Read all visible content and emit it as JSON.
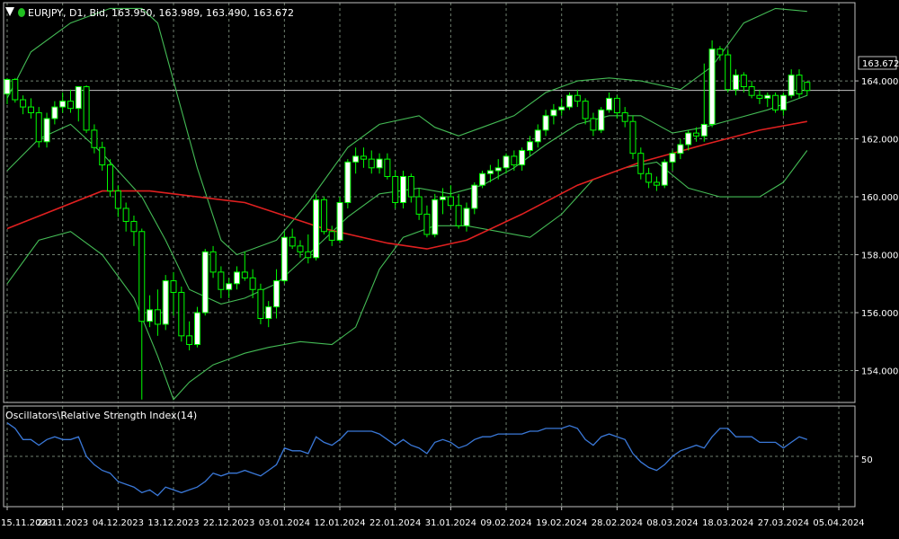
{
  "header": {
    "info": "EURJPY, D1, Bid, 163.950, 163.989, 163.490, 163.672",
    "dropdown_icon": "triangle-down-icon",
    "status_dot_color": "#20c020"
  },
  "indicator": {
    "label": "Oscillators\\Relative Strength Index(14)",
    "level_label": "50"
  },
  "colors": {
    "background": "#000000",
    "grid": "#6f7f6f",
    "frame": "#c0c0c0",
    "bull_candle": "#ffffff",
    "bear_candle": "#000000",
    "candle_wick": "#00ff00",
    "bollinger": "#44bb55",
    "ma": "#e02020",
    "rsi": "#3a78d8",
    "price_line": "#c0c0c0"
  },
  "chart_data": {
    "type": "candlestick",
    "symbol": "EURJPY",
    "timeframe": "D1",
    "ylim": [
      152.9,
      166.7
    ],
    "y_ticks": [
      "164.000",
      "162.000",
      "160.000",
      "158.000",
      "156.000",
      "154.000"
    ],
    "y_tick_values": [
      164,
      162,
      160,
      158,
      156,
      154
    ],
    "current_price_label": "163.672",
    "current_price": 163.672,
    "x_ticks": [
      "15.11.2023",
      "24.11.2023",
      "04.12.2023",
      "13.12.2023",
      "22.12.2023",
      "03.01.2024",
      "12.01.2024",
      "22.01.2024",
      "31.01.2024",
      "09.02.2024",
      "19.02.2024",
      "28.02.2024",
      "08.03.2024",
      "18.03.2024",
      "27.03.2024",
      "05.04.2024"
    ],
    "x_tick_indices": [
      0,
      7,
      14,
      21,
      28,
      35,
      42,
      49,
      56,
      63,
      70,
      77,
      84,
      91,
      98,
      105
    ],
    "ohlc": [
      [
        163.55,
        164.1,
        163.2,
        164.05
      ],
      [
        164.05,
        164.1,
        163.25,
        163.35
      ],
      [
        163.35,
        163.5,
        162.85,
        163.1
      ],
      [
        163.1,
        163.4,
        162.7,
        162.9
      ],
      [
        162.9,
        163.1,
        161.7,
        161.9
      ],
      [
        161.9,
        162.9,
        161.7,
        162.7
      ],
      [
        162.7,
        163.3,
        162.5,
        163.1
      ],
      [
        163.1,
        163.6,
        162.9,
        163.3
      ],
      [
        163.3,
        163.7,
        162.9,
        163.05
      ],
      [
        163.05,
        163.8,
        162.6,
        163.8
      ],
      [
        163.8,
        163.85,
        162.2,
        162.3
      ],
      [
        162.3,
        162.5,
        161.5,
        161.7
      ],
      [
        161.7,
        161.9,
        160.9,
        161.1
      ],
      [
        161.1,
        161.3,
        160.0,
        160.2
      ],
      [
        160.2,
        160.4,
        159.3,
        159.6
      ],
      [
        159.6,
        159.8,
        158.8,
        159.15
      ],
      [
        159.15,
        159.35,
        158.3,
        158.8
      ],
      [
        158.8,
        158.9,
        153.0,
        155.7
      ],
      [
        155.7,
        156.6,
        155.5,
        156.1
      ],
      [
        156.1,
        156.8,
        155.2,
        155.6
      ],
      [
        155.6,
        157.3,
        155.4,
        157.1
      ],
      [
        157.1,
        157.4,
        155.9,
        156.7
      ],
      [
        156.7,
        156.9,
        155.0,
        155.2
      ],
      [
        155.2,
        155.7,
        154.7,
        154.9
      ],
      [
        154.9,
        156.2,
        154.8,
        156.0
      ],
      [
        156.0,
        158.2,
        155.9,
        158.1
      ],
      [
        158.1,
        158.3,
        157.2,
        157.4
      ],
      [
        157.4,
        157.6,
        156.5,
        156.8
      ],
      [
        156.8,
        157.2,
        156.5,
        157.0
      ],
      [
        157.0,
        157.6,
        156.8,
        157.4
      ],
      [
        157.4,
        158.1,
        157.1,
        157.2
      ],
      [
        157.2,
        157.5,
        156.5,
        156.8
      ],
      [
        156.8,
        157.0,
        155.6,
        155.8
      ],
      [
        155.8,
        156.4,
        155.5,
        156.2
      ],
      [
        156.2,
        157.5,
        155.8,
        157.1
      ],
      [
        157.1,
        158.8,
        157.0,
        158.6
      ],
      [
        158.6,
        158.9,
        158.2,
        158.3
      ],
      [
        158.3,
        158.5,
        157.9,
        158.1
      ],
      [
        158.1,
        158.7,
        157.7,
        157.9
      ],
      [
        157.9,
        160.1,
        157.8,
        159.9
      ],
      [
        159.9,
        160.0,
        158.7,
        158.8
      ],
      [
        158.8,
        159.0,
        158.3,
        158.5
      ],
      [
        158.5,
        160.0,
        158.4,
        159.8
      ],
      [
        159.8,
        161.3,
        159.6,
        161.2
      ],
      [
        161.2,
        161.7,
        160.8,
        161.4
      ],
      [
        161.4,
        161.7,
        161.0,
        161.3
      ],
      [
        161.3,
        161.6,
        160.8,
        161.0
      ],
      [
        161.0,
        161.5,
        160.8,
        161.3
      ],
      [
        161.3,
        161.5,
        160.6,
        160.7
      ],
      [
        160.7,
        160.9,
        159.6,
        159.8
      ],
      [
        159.8,
        160.9,
        159.6,
        160.7
      ],
      [
        160.7,
        160.8,
        159.8,
        160.0
      ],
      [
        160.0,
        160.3,
        159.2,
        159.4
      ],
      [
        159.4,
        159.7,
        158.6,
        158.7
      ],
      [
        158.7,
        160.1,
        158.6,
        159.9
      ],
      [
        159.9,
        160.3,
        159.4,
        160.0
      ],
      [
        160.0,
        160.4,
        159.6,
        159.7
      ],
      [
        159.7,
        160.1,
        158.9,
        159.0
      ],
      [
        159.0,
        159.8,
        158.8,
        159.6
      ],
      [
        159.6,
        160.5,
        159.4,
        160.4
      ],
      [
        160.4,
        160.9,
        160.3,
        160.8
      ],
      [
        160.8,
        161.1,
        160.5,
        160.9
      ],
      [
        160.9,
        161.3,
        160.6,
        161.0
      ],
      [
        161.0,
        161.5,
        160.8,
        161.4
      ],
      [
        161.4,
        161.6,
        160.9,
        161.1
      ],
      [
        161.1,
        161.7,
        160.9,
        161.6
      ],
      [
        161.6,
        162.1,
        161.4,
        161.9
      ],
      [
        161.9,
        162.5,
        161.7,
        162.3
      ],
      [
        162.3,
        163.0,
        162.1,
        162.8
      ],
      [
        162.8,
        163.2,
        162.5,
        163.0
      ],
      [
        163.0,
        163.4,
        162.8,
        163.1
      ],
      [
        163.1,
        163.6,
        163.0,
        163.5
      ],
      [
        163.5,
        163.7,
        163.1,
        163.3
      ],
      [
        163.3,
        163.4,
        162.5,
        162.7
      ],
      [
        162.7,
        162.9,
        162.1,
        162.3
      ],
      [
        162.3,
        163.1,
        162.2,
        163.0
      ],
      [
        163.0,
        163.6,
        162.9,
        163.4
      ],
      [
        163.4,
        163.5,
        162.7,
        162.9
      ],
      [
        162.9,
        163.1,
        162.4,
        162.6
      ],
      [
        162.6,
        162.8,
        161.3,
        161.5
      ],
      [
        161.5,
        161.7,
        160.6,
        160.8
      ],
      [
        160.8,
        161.0,
        160.3,
        160.5
      ],
      [
        160.5,
        160.7,
        160.2,
        160.4
      ],
      [
        160.4,
        161.3,
        160.3,
        161.2
      ],
      [
        161.2,
        161.6,
        160.9,
        161.5
      ],
      [
        161.5,
        162.0,
        161.3,
        161.8
      ],
      [
        161.8,
        162.3,
        161.6,
        162.2
      ],
      [
        162.2,
        162.4,
        161.9,
        162.1
      ],
      [
        162.1,
        164.6,
        161.9,
        162.5
      ],
      [
        162.5,
        165.4,
        162.4,
        165.1
      ],
      [
        165.1,
        165.2,
        164.7,
        164.9
      ],
      [
        164.9,
        165.1,
        163.6,
        163.7
      ],
      [
        163.7,
        164.4,
        163.5,
        164.2
      ],
      [
        164.2,
        164.3,
        163.6,
        163.8
      ],
      [
        163.8,
        164.0,
        163.4,
        163.5
      ],
      [
        163.5,
        163.7,
        163.2,
        163.4
      ],
      [
        163.4,
        163.6,
        163.1,
        163.5
      ],
      [
        163.5,
        163.6,
        162.9,
        163.0
      ],
      [
        163.0,
        163.6,
        162.8,
        163.5
      ],
      [
        163.5,
        164.4,
        163.4,
        164.2
      ],
      [
        164.2,
        164.4,
        163.4,
        163.55
      ],
      [
        163.95,
        163.99,
        163.49,
        163.67
      ]
    ],
    "ma": [
      [
        0,
        158.9
      ],
      [
        12,
        160.2
      ],
      [
        18,
        160.2
      ],
      [
        30,
        159.8
      ],
      [
        40,
        158.9
      ],
      [
        48,
        158.4
      ],
      [
        53,
        158.2
      ],
      [
        58,
        158.5
      ],
      [
        65,
        159.4
      ],
      [
        72,
        160.4
      ],
      [
        80,
        161.2
      ],
      [
        88,
        161.8
      ],
      [
        95,
        162.3
      ],
      [
        101,
        162.6
      ]
    ],
    "bb_upper": [
      [
        0,
        163.4
      ],
      [
        3,
        165.0
      ],
      [
        8,
        166.0
      ],
      [
        13,
        166.5
      ],
      [
        17,
        166.5
      ],
      [
        19,
        166.0
      ],
      [
        21,
        164.0
      ],
      [
        24,
        161.0
      ],
      [
        27,
        158.5
      ],
      [
        29,
        158.0
      ],
      [
        31,
        158.2
      ],
      [
        34,
        158.5
      ],
      [
        38,
        159.8
      ],
      [
        43,
        161.7
      ],
      [
        47,
        162.5
      ],
      [
        52,
        162.8
      ],
      [
        54,
        162.4
      ],
      [
        57,
        162.1
      ],
      [
        60,
        162.4
      ],
      [
        64,
        162.8
      ],
      [
        68,
        163.6
      ],
      [
        72,
        164.0
      ],
      [
        76,
        164.1
      ],
      [
        80,
        164.0
      ],
      [
        85,
        163.7
      ],
      [
        89,
        164.5
      ],
      [
        93,
        166.0
      ],
      [
        97,
        166.5
      ],
      [
        101,
        166.4
      ]
    ],
    "bb_mid": [
      [
        0,
        160.9
      ],
      [
        4,
        162.0
      ],
      [
        8,
        162.5
      ],
      [
        12,
        161.5
      ],
      [
        17,
        160.0
      ],
      [
        20,
        158.5
      ],
      [
        23,
        156.8
      ],
      [
        27,
        156.3
      ],
      [
        30,
        156.5
      ],
      [
        34,
        157.0
      ],
      [
        38,
        158.0
      ],
      [
        43,
        159.3
      ],
      [
        47,
        160.1
      ],
      [
        52,
        160.3
      ],
      [
        56,
        160.1
      ],
      [
        60,
        160.4
      ],
      [
        64,
        161.0
      ],
      [
        68,
        161.8
      ],
      [
        72,
        162.5
      ],
      [
        76,
        162.8
      ],
      [
        80,
        162.8
      ],
      [
        84,
        162.2
      ],
      [
        88,
        162.4
      ],
      [
        92,
        162.7
      ],
      [
        96,
        163.0
      ],
      [
        101,
        163.5
      ]
    ],
    "bb_lower": [
      [
        0,
        157.0
      ],
      [
        4,
        158.5
      ],
      [
        8,
        158.8
      ],
      [
        12,
        158.0
      ],
      [
        16,
        156.5
      ],
      [
        19,
        154.5
      ],
      [
        21,
        153.0
      ],
      [
        23,
        153.6
      ],
      [
        26,
        154.2
      ],
      [
        30,
        154.6
      ],
      [
        33,
        154.8
      ],
      [
        37,
        155.0
      ],
      [
        41,
        154.9
      ],
      [
        44,
        155.5
      ],
      [
        47,
        157.5
      ],
      [
        50,
        158.6
      ],
      [
        54,
        159.0
      ],
      [
        58,
        159.0
      ],
      [
        62,
        158.8
      ],
      [
        66,
        158.6
      ],
      [
        70,
        159.4
      ],
      [
        74,
        160.6
      ],
      [
        78,
        161.0
      ],
      [
        82,
        161.2
      ],
      [
        86,
        160.3
      ],
      [
        90,
        160.0
      ],
      [
        95,
        160.0
      ],
      [
        98,
        160.5
      ],
      [
        101,
        161.6
      ]
    ],
    "rsi": {
      "name": "Relative Strength Index(14)",
      "level": 50,
      "ylim": [
        32,
        68
      ],
      "values": [
        62,
        60,
        56,
        56,
        54,
        56,
        57,
        56,
        56,
        57,
        50,
        47,
        45,
        44,
        41,
        40,
        39,
        37,
        38,
        36,
        39,
        38,
        37,
        38,
        39,
        41,
        44,
        43,
        44,
        44,
        45,
        44,
        43,
        45,
        47,
        53,
        52,
        52,
        51,
        57,
        55,
        54,
        56,
        59,
        59,
        59,
        59,
        58,
        56,
        54,
        56,
        54,
        53,
        51,
        55,
        56,
        55,
        53,
        54,
        56,
        57,
        57,
        58,
        58,
        58,
        58,
        59,
        59,
        60,
        60,
        60,
        61,
        60,
        56,
        54,
        57,
        58,
        57,
        56,
        51,
        48,
        46,
        45,
        47,
        50,
        52,
        53,
        54,
        53,
        57,
        60,
        60,
        57,
        57,
        57,
        55,
        55,
        55,
        53,
        55,
        57,
        56
      ]
    }
  }
}
